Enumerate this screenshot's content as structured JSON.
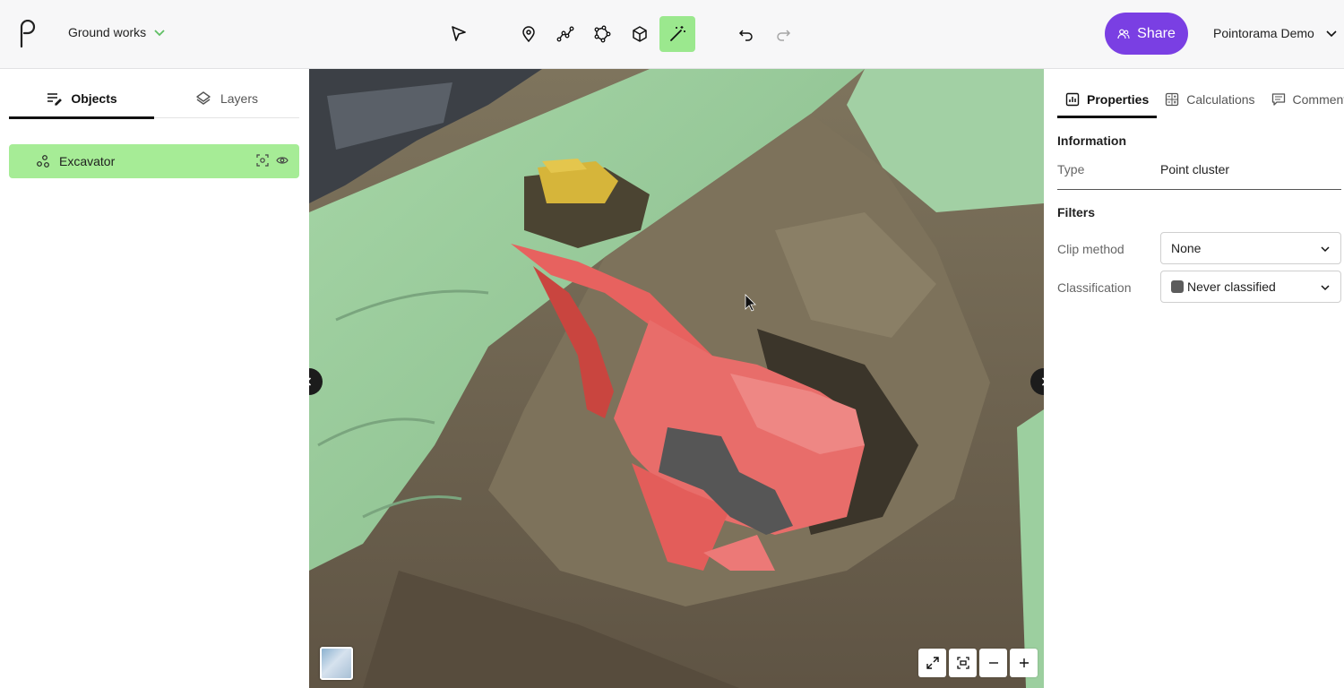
{
  "app": {
    "project_name": "Ground works",
    "user_name": "Pointorama Demo",
    "share_label": "Share"
  },
  "toolbar": {
    "tools": [
      {
        "name": "select-tool",
        "icon": "pointer-icon"
      },
      {
        "name": "point-tool",
        "icon": "map-pin-icon"
      },
      {
        "name": "polyline-tool",
        "icon": "polyline-icon"
      },
      {
        "name": "polygon-tool",
        "icon": "polygon-icon"
      },
      {
        "name": "box-tool",
        "icon": "cube-icon"
      },
      {
        "name": "magic-wand-tool",
        "icon": "magic-wand-icon",
        "active": true
      },
      {
        "name": "undo-button",
        "icon": "undo-icon"
      },
      {
        "name": "redo-button",
        "icon": "redo-icon",
        "disabled": true
      }
    ],
    "active_color": "#9be88e"
  },
  "left_panel": {
    "tabs": [
      {
        "label": "Objects",
        "icon": "objects-icon",
        "active": true
      },
      {
        "label": "Layers",
        "icon": "layers-icon",
        "active": false
      }
    ],
    "objects": [
      {
        "label": "Excavator",
        "icon": "point-cluster-icon",
        "selected": true
      }
    ],
    "selected_color": "#a6ec96"
  },
  "right_panel": {
    "tabs": [
      {
        "label": "Properties",
        "icon": "bar-chart-icon",
        "active": true
      },
      {
        "label": "Calculations",
        "icon": "calculator-icon",
        "active": false
      },
      {
        "label": "Comments",
        "icon": "comment-icon",
        "active": false
      }
    ],
    "information": {
      "title": "Information",
      "type_label": "Type",
      "type_value": "Point cluster"
    },
    "filters": {
      "title": "Filters",
      "clip_label": "Clip method",
      "clip_value": "None",
      "class_label": "Classification",
      "class_value": "Never classified"
    }
  },
  "colors": {
    "brand": "#7a3fe3",
    "ground_green": "#9ccf9f",
    "selection_red": "#ea6a68",
    "dirt": "#6d6250"
  }
}
